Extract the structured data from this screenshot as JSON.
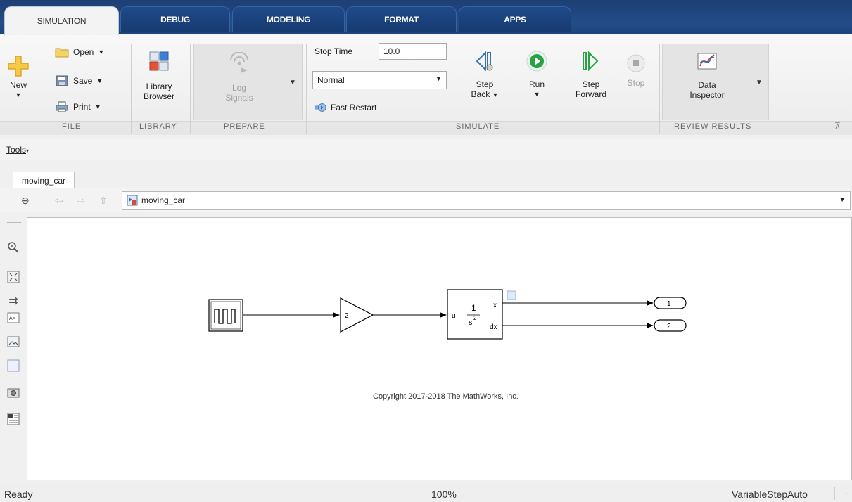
{
  "tabs": [
    {
      "label": "SIMULATION"
    },
    {
      "label": "DEBUG"
    },
    {
      "label": "MODELING"
    },
    {
      "label": "FORMAT"
    },
    {
      "label": "APPS"
    }
  ],
  "ribbon": {
    "file": {
      "group": "FILE",
      "new": "New",
      "open": "Open",
      "save": "Save",
      "print": "Print"
    },
    "library": {
      "group": "LIBRARY",
      "browser_line1": "Library",
      "browser_line2": "Browser"
    },
    "prepare": {
      "group": "PREPARE",
      "log_line1": "Log",
      "log_line2": "Signals"
    },
    "simulate": {
      "group": "SIMULATE",
      "stop_time_label": "Stop Time",
      "stop_time_value": "10.0",
      "mode_value": "Normal",
      "fast_restart": "Fast Restart",
      "step_back_line1": "Step",
      "step_back_line2": "Back",
      "run": "Run",
      "step_forward_line1": "Step",
      "step_forward_line2": "Forward",
      "stop": "Stop"
    },
    "review": {
      "group": "REVIEW RESULTS",
      "data_line1": "Data",
      "data_line2": "Inspector"
    }
  },
  "menu": {
    "tools": "Tools"
  },
  "model_tab": "moving_car",
  "address": "moving_car",
  "diagram": {
    "gain_value": "2",
    "integrator_input": "u",
    "integrator_num": "1",
    "integrator_den": "s",
    "integrator_exp": "2",
    "integrator_out_x": "x",
    "integrator_out_dx": "dx",
    "outport1": "1",
    "outport2": "2",
    "copyright": "Copyright 2017-2018 The MathWorks, Inc."
  },
  "status": {
    "state": "Ready",
    "zoom": "100%",
    "solver": "VariableStepAuto"
  },
  "colors": {
    "tabstrip": "#1d3f74",
    "run_green": "#27a345",
    "step_blue": "#3a6fb0"
  }
}
